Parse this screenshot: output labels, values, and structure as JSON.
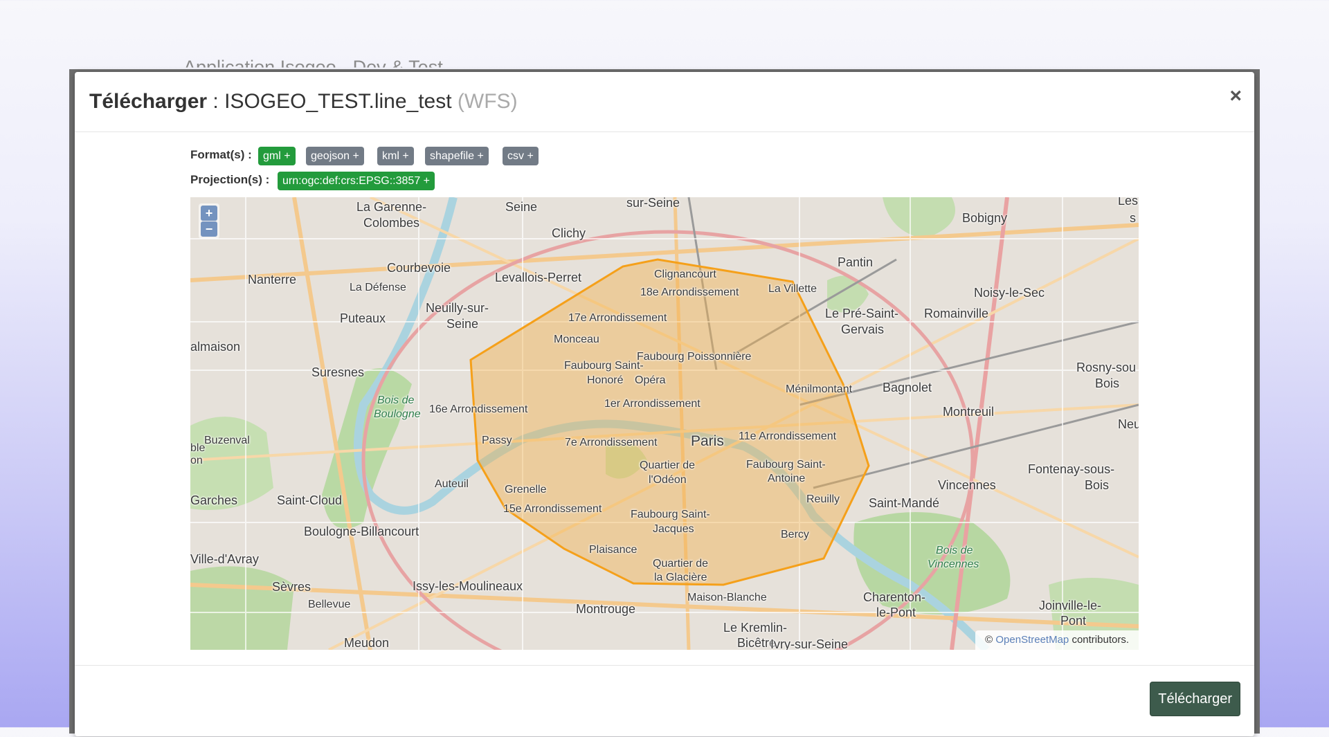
{
  "background_title": "Application Isogeo - Dev & Test",
  "modal": {
    "title_label": "Télécharger",
    "title_sep": " : ",
    "dataset_name": "ISOGEO_TEST.line_test",
    "service_type": "(WFS)",
    "close": "×"
  },
  "formats": {
    "label": "Format(s) :",
    "items": [
      "gml +",
      "geojson +",
      "kml +",
      "shapefile +",
      "csv +"
    ],
    "selected": "gml +"
  },
  "projections": {
    "label": "Projection(s) :",
    "items": [
      "urn:ogc:def:crs:EPSG::3857 +"
    ]
  },
  "map": {
    "zoom_in": "+",
    "zoom_out": "−",
    "attribution_prefix": "©",
    "attribution_link": "OpenStreetMap",
    "attribution_suffix": "contributors.",
    "labels": [
      "sur-Seine",
      "La Garenne-",
      "Colombes",
      "Seine",
      "Clichy",
      "Bobigny",
      "Les",
      "s",
      "Nanterre",
      "La Défense",
      "Courbevoie",
      "Levallois-Perret",
      "Clignancourt",
      "18e Arrondissement",
      "La Villette",
      "Pantin",
      "Noisy-le-Sec",
      "Puteaux",
      "Neuilly-sur-",
      "Seine",
      "17e Arrondissement",
      "Le Pré-Saint-",
      "Gervais",
      "Romainville",
      "almaison",
      "Monceau",
      "Faubourg Poissonnière",
      "Faubourg Saint-",
      "Honoré",
      "Opéra",
      "Rosny-sou",
      "Bois",
      "Suresnes",
      "Ménilmontant",
      "Bagnolet",
      "Bois de",
      "Boulogne",
      "16e Arrondissement",
      "1er Arrondissement",
      "Montreuil",
      "Neu",
      "Buzenval",
      "ble",
      "on",
      "Passy",
      "7e Arrondissement",
      "Paris",
      "11e Arrondissement",
      "Auteuil",
      "Quartier de",
      "l'Odéon",
      "Faubourg Saint-",
      "Antoine",
      "Fontenay-sous-",
      "Bois",
      "Vincennes",
      "Garches",
      "Saint-Cloud",
      "Grenelle",
      "Reuilly",
      "Saint-Mandé",
      "Boulogne-Billancourt",
      "15e Arrondissement",
      "Faubourg Saint-",
      "Jacques",
      "Bercy",
      "Ville-d'Avray",
      "Plaisance",
      "Quartier de",
      "la Glacière",
      "Bois de",
      "Vincennes",
      "Sèvres",
      "Issy-les-Moulineaux",
      "Bellevue",
      "Maison-Blanche",
      "Charenton-",
      "le-Pont",
      "Joinville-le-",
      "Pont",
      "Montrouge",
      "Meudon",
      "Le Kremlin-",
      "Bicêtre",
      "Ivry-sur-Seine"
    ]
  },
  "footer": {
    "download": "Télécharger"
  },
  "colors": {
    "tag_selected": "#239b3c",
    "tag_default": "#727b86",
    "download_button": "#3d5b4c",
    "polygon_stroke": "#f5a01a",
    "polygon_fill": "#f2b04a"
  }
}
